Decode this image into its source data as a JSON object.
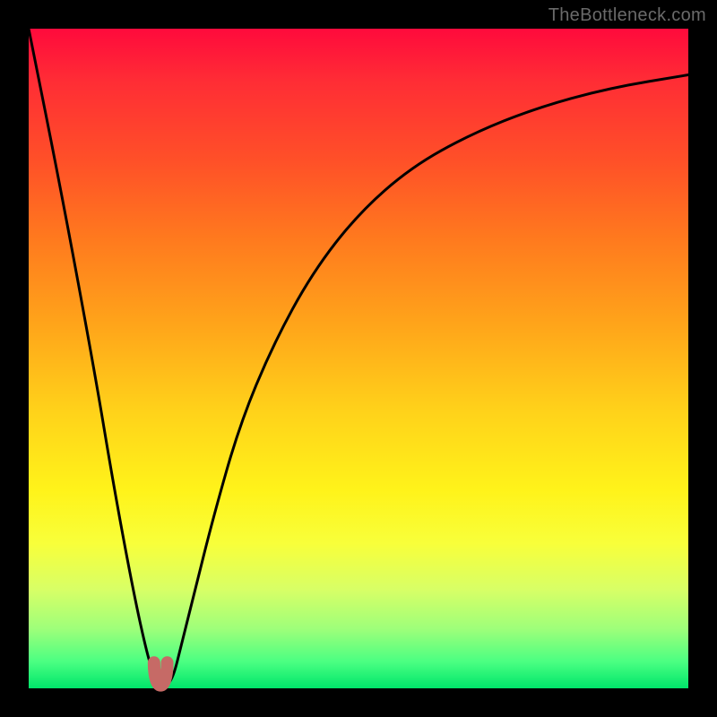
{
  "watermark": "TheBottleneck.com",
  "chart_data": {
    "type": "line",
    "title": "",
    "xlabel": "",
    "ylabel": "",
    "xlim": [
      0,
      100
    ],
    "ylim": [
      0,
      100
    ],
    "legend": false,
    "grid": false,
    "series": [
      {
        "name": "bottleneck-curve",
        "x": [
          0,
          5,
          10,
          13,
          16,
          18,
          19,
          20,
          21,
          22,
          23,
          25,
          28,
          32,
          37,
          43,
          50,
          58,
          67,
          77,
          88,
          100
        ],
        "y": [
          100,
          75,
          48,
          30,
          14,
          5,
          2,
          0.4,
          0.4,
          2,
          6,
          14,
          26,
          40,
          52,
          63,
          72,
          79,
          84,
          88,
          91,
          93
        ]
      }
    ],
    "marker": {
      "name": "optimal-point",
      "x_range": [
        19,
        21
      ],
      "y": 0.4,
      "color": "#c66a66"
    },
    "background_gradient": {
      "top": "#ff0a3c",
      "bottom": "#00e56a"
    }
  }
}
